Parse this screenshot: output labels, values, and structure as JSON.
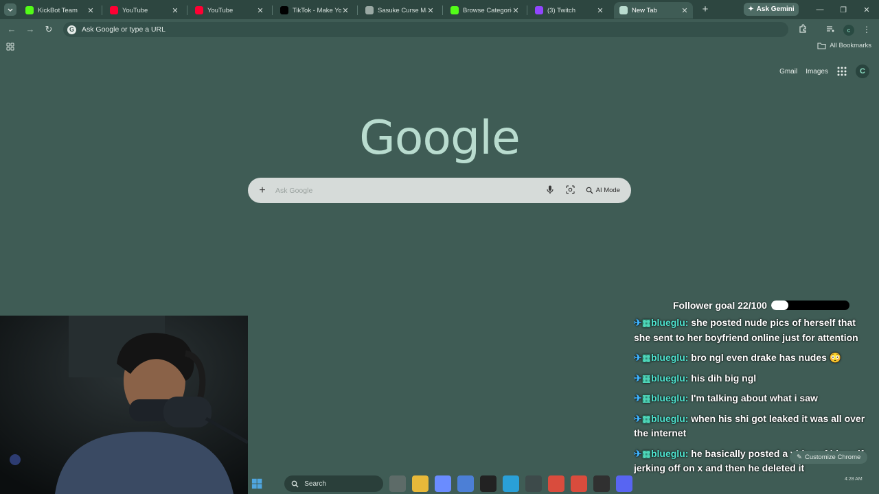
{
  "tabs": [
    {
      "title": "KickBot Team",
      "favicon": "kickbot-icon",
      "color": "#53fc18",
      "active": false
    },
    {
      "title": "YouTube",
      "favicon": "youtube-icon",
      "color": "#ff0033",
      "active": false
    },
    {
      "title": "YouTube",
      "favicon": "youtube-icon",
      "color": "#ff0033",
      "active": false
    },
    {
      "title": "TikTok - Make Your Day",
      "favicon": "tiktok-icon",
      "color": "#000000",
      "active": false
    },
    {
      "title": "Sasuke Curse Mark",
      "favicon": "globe-icon",
      "color": "#9aa9a4",
      "active": false
    },
    {
      "title": "Browse Categories",
      "favicon": "kick-icon",
      "color": "#53fc18",
      "active": false
    },
    {
      "title": "(3) Twitch",
      "favicon": "twitch-icon",
      "color": "#9146ff",
      "active": false
    },
    {
      "title": "New Tab",
      "favicon": "chrome-icon",
      "color": "#b9dccf",
      "active": true
    }
  ],
  "gemini_label": "Ask Gemini",
  "omnibox": {
    "placeholder": "Ask Google or type a URL"
  },
  "profile_initial": "c",
  "bookmarks": {
    "all_label": "All Bookmarks"
  },
  "ntp": {
    "gmail": "Gmail",
    "images": "Images",
    "avatar": "C",
    "logo": "Google",
    "search_placeholder": "Ask Google",
    "ai_mode": "AI Mode",
    "customize": "Customize Chrome"
  },
  "stream": {
    "goal_label": "Follower goal 22/100",
    "goal_fraction": 0.22,
    "chat": [
      {
        "user": "blueglu:",
        "text": "she posted nude pics of herself that she sent to her boyfriend online just for attention"
      },
      {
        "user": "blueglu:",
        "text": "bro ngl even drake has nudes 😳"
      },
      {
        "user": "blueglu:",
        "text": "his dih big ngl"
      },
      {
        "user": "blueglu:",
        "text": "I'm talking about what i saw"
      },
      {
        "user": "blueglu:",
        "text": "when his shi got leaked it was all over the internet"
      },
      {
        "user": "blueglu:",
        "text": "he basically posted a video of himself jerking off on x and then he deleted it"
      }
    ]
  },
  "taskbar": {
    "search_label": "Search",
    "apps": [
      "task-view-icon",
      "file-explorer-icon",
      "copilot-icon",
      "store-icon",
      "capcut-icon",
      "edge-icon",
      "notepad-icon",
      "chrome-icon",
      "chrome-icon",
      "obs-icon",
      "discord-icon"
    ],
    "clock_time": "4:28 AM"
  }
}
